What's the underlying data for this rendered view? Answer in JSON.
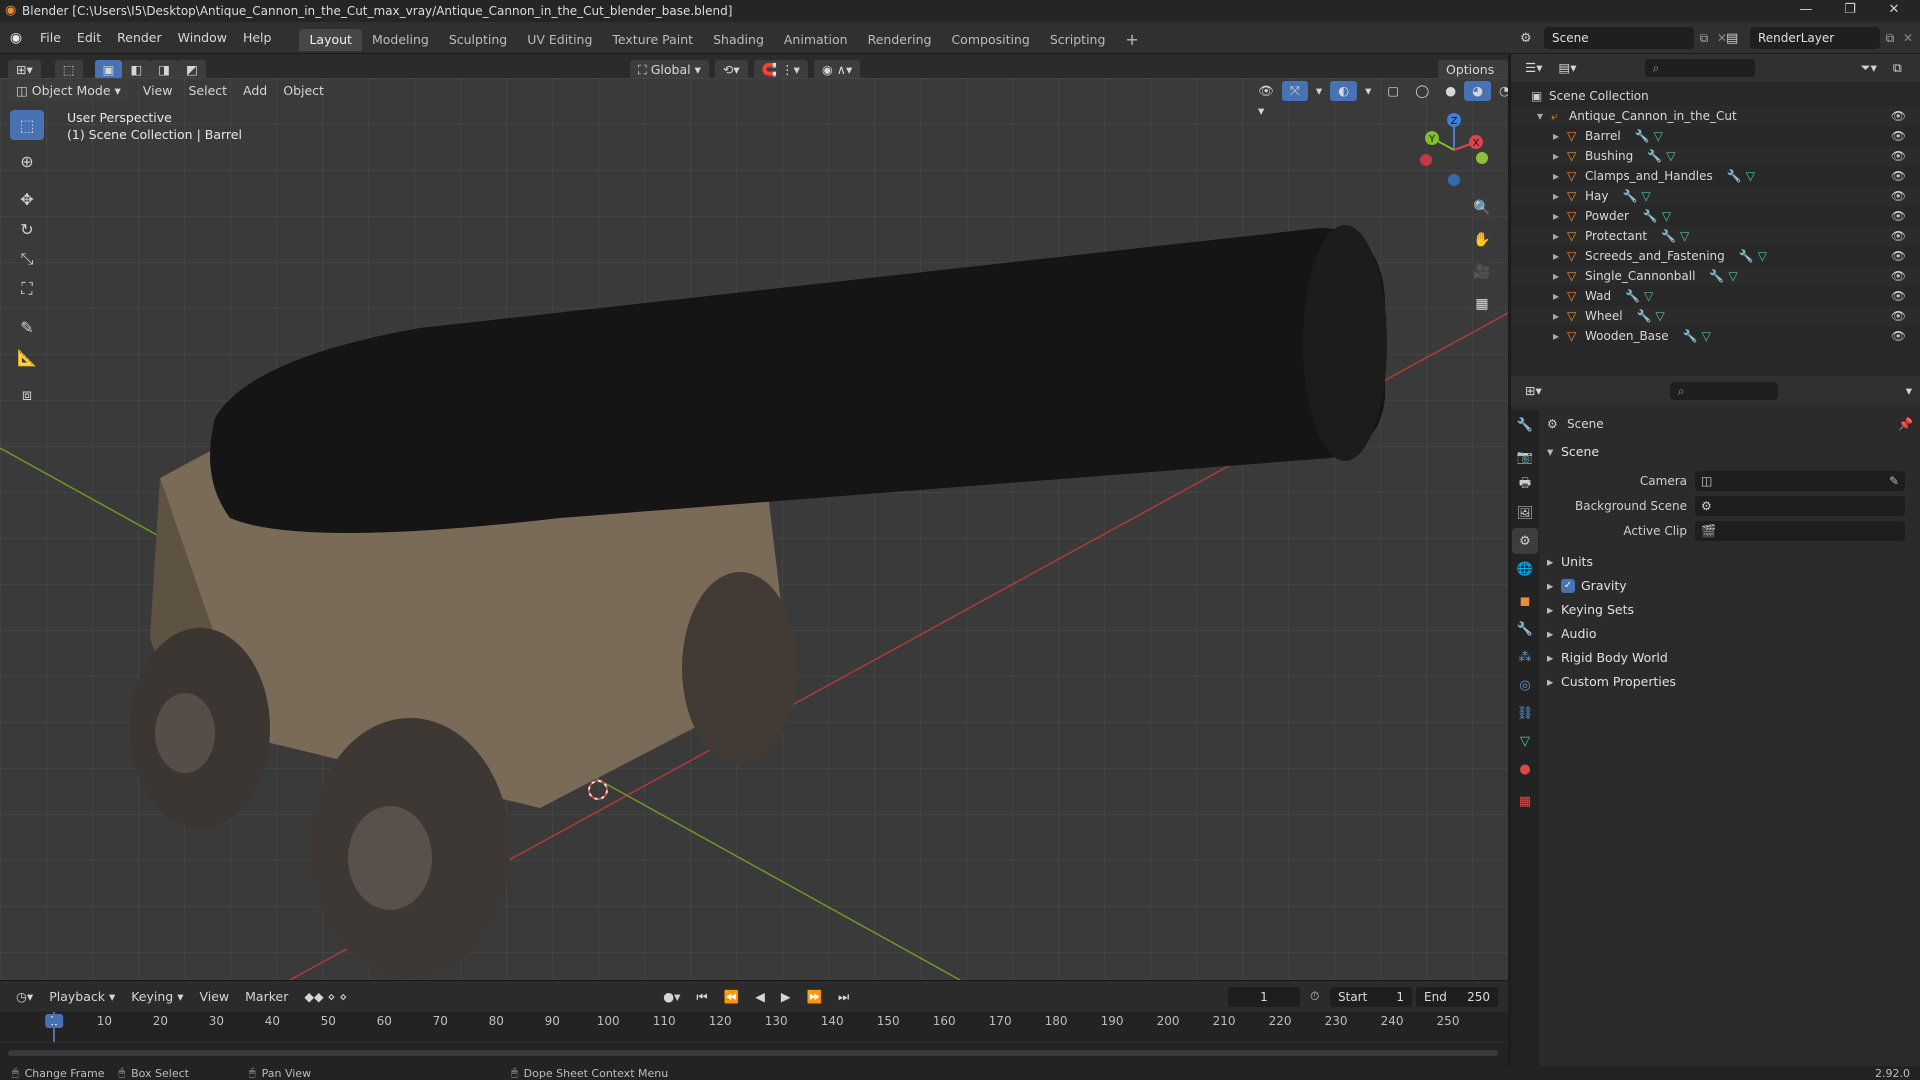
{
  "window": {
    "title": "Blender [C:\\Users\\I5\\Desktop\\Antique_Cannon_in_the_Cut_max_vray/Antique_Cannon_in_the_Cut_blender_base.blend]",
    "minimize": "—",
    "maximize": "❐",
    "close": "✕"
  },
  "menu": [
    "File",
    "Edit",
    "Render",
    "Window",
    "Help"
  ],
  "workspaces": [
    "Layout",
    "Modeling",
    "Sculpting",
    "UV Editing",
    "Texture Paint",
    "Shading",
    "Animation",
    "Rendering",
    "Compositing",
    "Scripting"
  ],
  "workspace_add": "+",
  "scene_field": "Scene",
  "renderlayer_field": "RenderLayer",
  "viewport_header": {
    "orientation": "Global",
    "options": "Options",
    "mode": "Object Mode",
    "menus": [
      "View",
      "Select",
      "Add",
      "Object"
    ]
  },
  "viewport_overlay": {
    "perspective": "User Perspective",
    "collection": "(1) Scene Collection | Barrel"
  },
  "gizmo": {
    "x": "X",
    "y": "Y",
    "z": "Z"
  },
  "outliner": {
    "root": "Scene Collection",
    "parent": "Antique_Cannon_in_the_Cut",
    "items": [
      "Barrel",
      "Bushing",
      "Clamps_and_Handles",
      "Hay",
      "Powder",
      "Protectant",
      "Screeds_and_Fastening",
      "Single_Cannonball",
      "Wad",
      "Wheel",
      "Wooden_Base"
    ]
  },
  "properties": {
    "context": "Scene",
    "panel": "Scene",
    "camera_label": "Camera",
    "background_label": "Background Scene",
    "clip_label": "Active Clip",
    "sections": [
      "Units",
      "Gravity",
      "Keying Sets",
      "Audio",
      "Rigid Body World",
      "Custom Properties"
    ],
    "gravity_checked": true
  },
  "timeline": {
    "menus": [
      "Playback",
      "Keying",
      "View",
      "Marker"
    ],
    "current_frame": "1",
    "start_label": "Start",
    "start_value": "1",
    "end_label": "End",
    "end_value": "250",
    "ticks": [
      "1",
      "10",
      "20",
      "30",
      "40",
      "50",
      "60",
      "70",
      "80",
      "90",
      "100",
      "110",
      "120",
      "130",
      "140",
      "150",
      "160",
      "170",
      "180",
      "190",
      "200",
      "210",
      "220",
      "230",
      "240",
      "250"
    ]
  },
  "statusbar": {
    "change_frame": "Change Frame",
    "box_select": "Box Select",
    "pan_view": "Pan View",
    "context_menu": "Dope Sheet Context Menu",
    "version": "2.92.0"
  },
  "colors": {
    "accent": "#4772b3",
    "x_axis": "#e0424e",
    "y_axis": "#7fbf2a",
    "z_axis": "#3d7fd9",
    "mesh_icon": "#e6913b",
    "data_icon": "#56c2a0"
  }
}
